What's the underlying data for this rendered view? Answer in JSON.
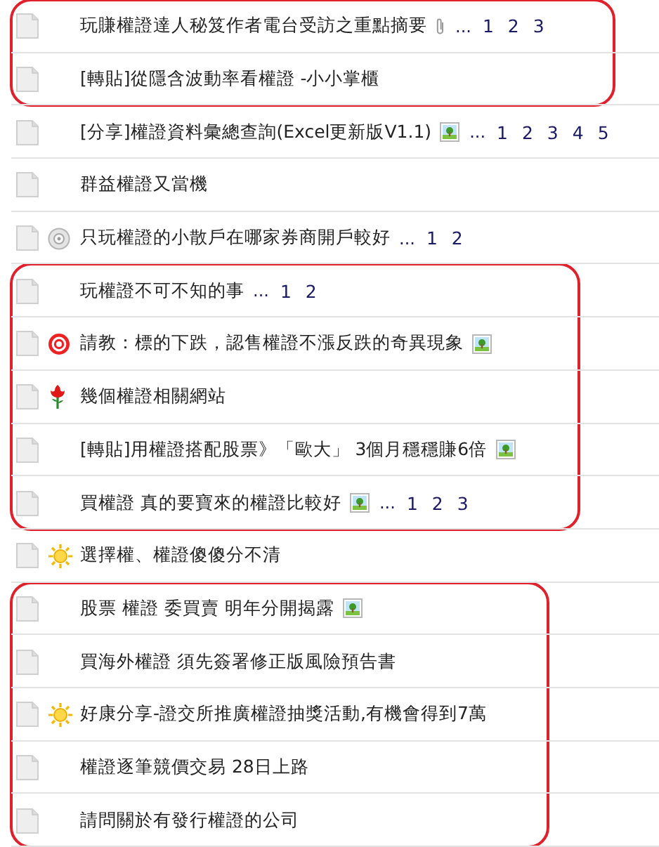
{
  "groups": [
    {
      "highlighted": true,
      "topics": [
        {
          "title": "玩賺權證達人秘笈作者電台受訪之重點摘要",
          "attachment": {
            "kind": "clip"
          },
          "ellipsis": "...",
          "pages": [
            "1",
            "2",
            "3"
          ]
        },
        {
          "title": "[轉貼]從隱含波動率看權證 -小小掌櫃"
        }
      ]
    },
    {
      "highlighted": false,
      "topics": [
        {
          "title": "[分享]權證資料彙總查詢(Excel更新版V1.1)",
          "attachment": {
            "kind": "image"
          },
          "ellipsis": "...",
          "pages": [
            "1",
            "2",
            "3",
            "4",
            "5"
          ]
        },
        {
          "title": "群益權證又當機"
        },
        {
          "badge": {
            "kind": "disc"
          },
          "title": "只玩權證的小散戶在哪家券商開戶較好",
          "ellipsis": "...",
          "pages": [
            "1",
            "2"
          ]
        }
      ]
    },
    {
      "highlighted": true,
      "topics": [
        {
          "title": "玩權證不可不知的事",
          "ellipsis": "...",
          "pages": [
            "1",
            "2"
          ]
        },
        {
          "badge": {
            "kind": "lifebuoy"
          },
          "title": "請教：標的下跌，認售權證不漲反跌的奇異現象",
          "attachment": {
            "kind": "image"
          }
        },
        {
          "badge": {
            "kind": "rose"
          },
          "title": "幾個權證相關網站"
        },
        {
          "title": "[轉貼]用權證搭配股票》「歐大」 3個月穩穩賺6倍",
          "attachment": {
            "kind": "image"
          }
        },
        {
          "title": "買權證 真的要寶來的權證比較好",
          "attachment": {
            "kind": "image"
          },
          "ellipsis": "...",
          "pages": [
            "1",
            "2",
            "3"
          ]
        }
      ]
    },
    {
      "highlighted": false,
      "topics": [
        {
          "badge": {
            "kind": "sun"
          },
          "title": "選擇權、權證傻傻分不清"
        }
      ]
    },
    {
      "highlighted": true,
      "topics": [
        {
          "title": "股票 權證 委買賣 明年分開揭露",
          "attachment": {
            "kind": "image"
          }
        },
        {
          "title": "買海外權證 須先簽署修正版風險預告書"
        },
        {
          "badge": {
            "kind": "sun"
          },
          "title": "好康分享-證交所推廣權證抽獎活動,有機會得到7萬"
        },
        {
          "title": "權證逐筆競價交易 28日上路"
        },
        {
          "title": "請問關於有發行權證的公司"
        }
      ]
    }
  ]
}
